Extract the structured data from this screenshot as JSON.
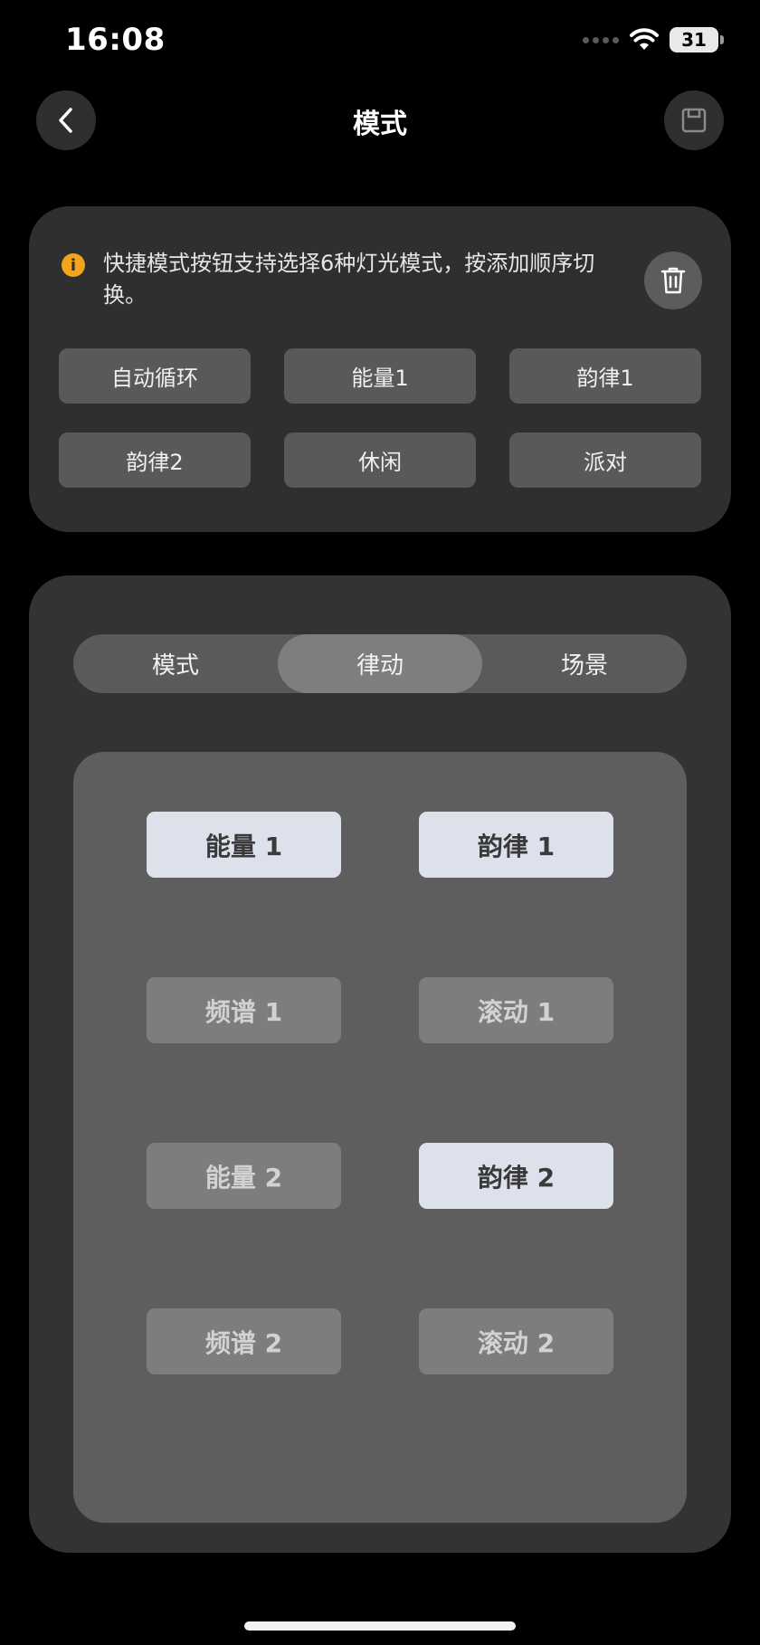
{
  "status_bar": {
    "time": "16:08",
    "battery": "31"
  },
  "header": {
    "title": "模式",
    "back_icon": "chevron-left-icon",
    "save_icon": "save-icon"
  },
  "quick_mode": {
    "info": "快捷模式按钮支持选择6种灯光模式，按添加顺序切换。",
    "info_icon": "info-icon",
    "delete_icon": "trash-icon",
    "items": [
      {
        "label": "自动循环"
      },
      {
        "label": "能量1"
      },
      {
        "label": "韵律1"
      },
      {
        "label": "韵律2"
      },
      {
        "label": "休闲"
      },
      {
        "label": "派对"
      }
    ]
  },
  "tabs": [
    {
      "label": "模式",
      "active": false
    },
    {
      "label": "律动",
      "active": true
    },
    {
      "label": "场景",
      "active": false
    }
  ],
  "effects": [
    {
      "label": "能量 1",
      "selected": true
    },
    {
      "label": "韵律 1",
      "selected": true
    },
    {
      "label": "频谱 1",
      "selected": false
    },
    {
      "label": "滚动 1",
      "selected": false
    },
    {
      "label": "能量 2",
      "selected": false
    },
    {
      "label": "韵律 2",
      "selected": true
    },
    {
      "label": "频谱 2",
      "selected": false
    },
    {
      "label": "滚动 2",
      "selected": false
    }
  ],
  "colors": {
    "accent_info": "#f2a51a",
    "selected_bg": "#dce1eb",
    "unselected_bg": "#7d7d7d",
    "card_bg": "#2f2f2f"
  }
}
